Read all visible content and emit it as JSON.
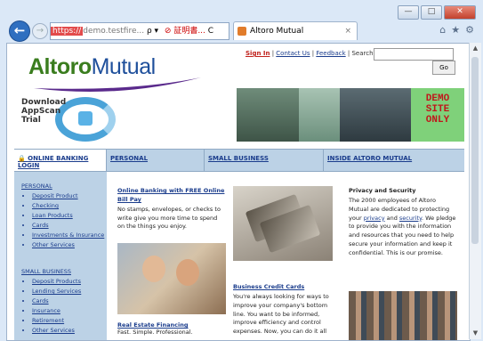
{
  "browser": {
    "address_protocol": "https://",
    "address_domain": "demo.testfire...",
    "address_search_suffix": "ρ ▾",
    "address_error": "⊘ 証明書...",
    "address_refresh": "C",
    "tab_title": "Altoro Mutual",
    "tab_close": "×",
    "back_glyph": "←",
    "forward_glyph": "→",
    "tools": [
      "⌂",
      "★",
      "⚙"
    ],
    "window_controls": [
      "—",
      "□",
      "✕"
    ]
  },
  "site": {
    "logo_part1": "Altoro",
    "logo_part2": "Mutual",
    "links": {
      "signin": "Sign In",
      "sep1": " | ",
      "contact": "Contact Us",
      "sep2": " | ",
      "feedback": "Feedback",
      "sep3": " | ",
      "search_label": "Search"
    },
    "go_button": "Go",
    "appscan_text1": "Download",
    "appscan_text2": "AppScan",
    "appscan_text3": "Trial",
    "banner_demo": "DEMO",
    "banner_site": "SITE",
    "banner_only": "ONLY",
    "nav": {
      "online_banking": "ONLINE BANKING LOGIN",
      "personal": "PERSONAL",
      "small_business": "SMALL BUSINESS",
      "inside": "INSIDE ALTORO MUTUAL"
    },
    "sidebar": {
      "personal_heading": "PERSONAL",
      "personal_items": [
        "Deposit Product",
        "Checking",
        "Loan Products",
        "Cards",
        "Investments & Insurance",
        "Other Services"
      ],
      "business_heading": "SMALL BUSINESS",
      "business_items": [
        "Deposit Products",
        "Lending Services",
        "Cards",
        "Insurance",
        "Retirement",
        "Other Services"
      ]
    },
    "col1": {
      "heading": "Online Banking with FREE Online Bill Pay",
      "body": "No stamps, envelopes, or checks to write give you more time to spend on the things you enjoy.",
      "heading2": "Real Estate Financing",
      "body2": "Fast. Simple. Professional."
    },
    "col2": {
      "heading": "Business Credit Cards",
      "body": "You're always looking for ways to improve your company's bottom line. You want to be informed, improve efficiency and control expenses. Now, you can do it all"
    },
    "col3": {
      "heading": "Privacy and Security",
      "body_a": "The 2000 employees of Altoro Mutual are dedicated to protecting your ",
      "privacy": "privacy",
      "body_b": " and ",
      "security": "security",
      "body_c": ". We pledge to provide you with the information and resources that you need to help secure your information and keep it confidential. This is our promise."
    }
  }
}
